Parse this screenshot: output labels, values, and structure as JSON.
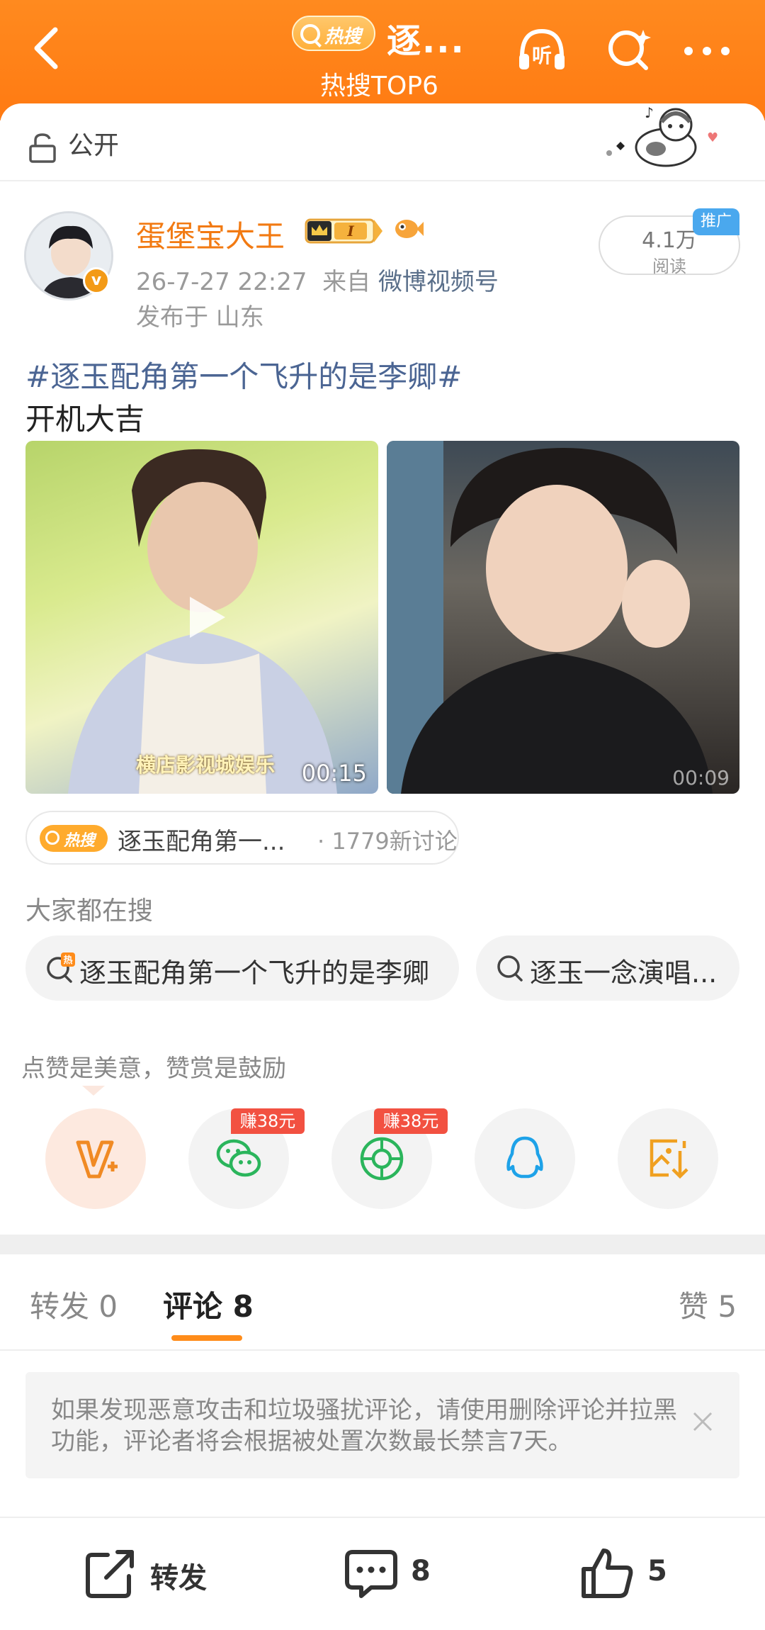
{
  "header": {
    "hot_badge": "热搜",
    "title": "逐...",
    "subtitle": "热搜TOP6",
    "listen_label": "听"
  },
  "visibility": {
    "label": "公开"
  },
  "post": {
    "username": "蛋堡宝大王",
    "level_badge": "I",
    "verified_mark": "v",
    "timestamp": "26-7-27 22:27",
    "source_prefix": "来自",
    "source": "微博视频号",
    "location": "发布于 山东",
    "reads_count": "4.1万",
    "reads_label": "阅读",
    "promo_label": "推广",
    "topic": "#逐玉配角第一个飞升的是李卿#",
    "text": "开机大吉",
    "media": [
      {
        "watermark": "横店影视城娱乐",
        "duration": "00:15"
      },
      {
        "duration": "00:09"
      }
    ]
  },
  "hot_tag": {
    "badge": "热搜",
    "title": "逐玉配角第一...",
    "count": "· 1779新讨论"
  },
  "search": {
    "heading": "大家都在搜",
    "chips": [
      {
        "text": "逐玉配角第一个飞升的是李卿",
        "icon": "hot-search-icon"
      },
      {
        "text": "逐玉一念演唱...",
        "icon": "search-icon"
      }
    ]
  },
  "reward": {
    "tip": "点赞是美意，赞赏是鼓励",
    "earn_badge_1": "赚38元",
    "earn_badge_2": "赚38元",
    "share_targets": [
      "reward-icon",
      "wechat-icon",
      "moments-icon",
      "qq-icon",
      "save-image-icon"
    ]
  },
  "tabs": {
    "repost": "转发 0",
    "comment": "评论 8",
    "like": "赞 5"
  },
  "notice": {
    "text": "如果发现恶意攻击和垃圾骚扰评论，请使用删除评论并拉黑功能，评论者将会根据被处置次数最长禁言7天。"
  },
  "bottom_bar": {
    "repost_label": "转发",
    "comment_count": "8",
    "like_count": "5"
  },
  "colors": {
    "brand_orange": "#ff7a12",
    "username_orange": "#f27a12",
    "link_blue": "#4b6593",
    "earn_red": "#f25141"
  }
}
